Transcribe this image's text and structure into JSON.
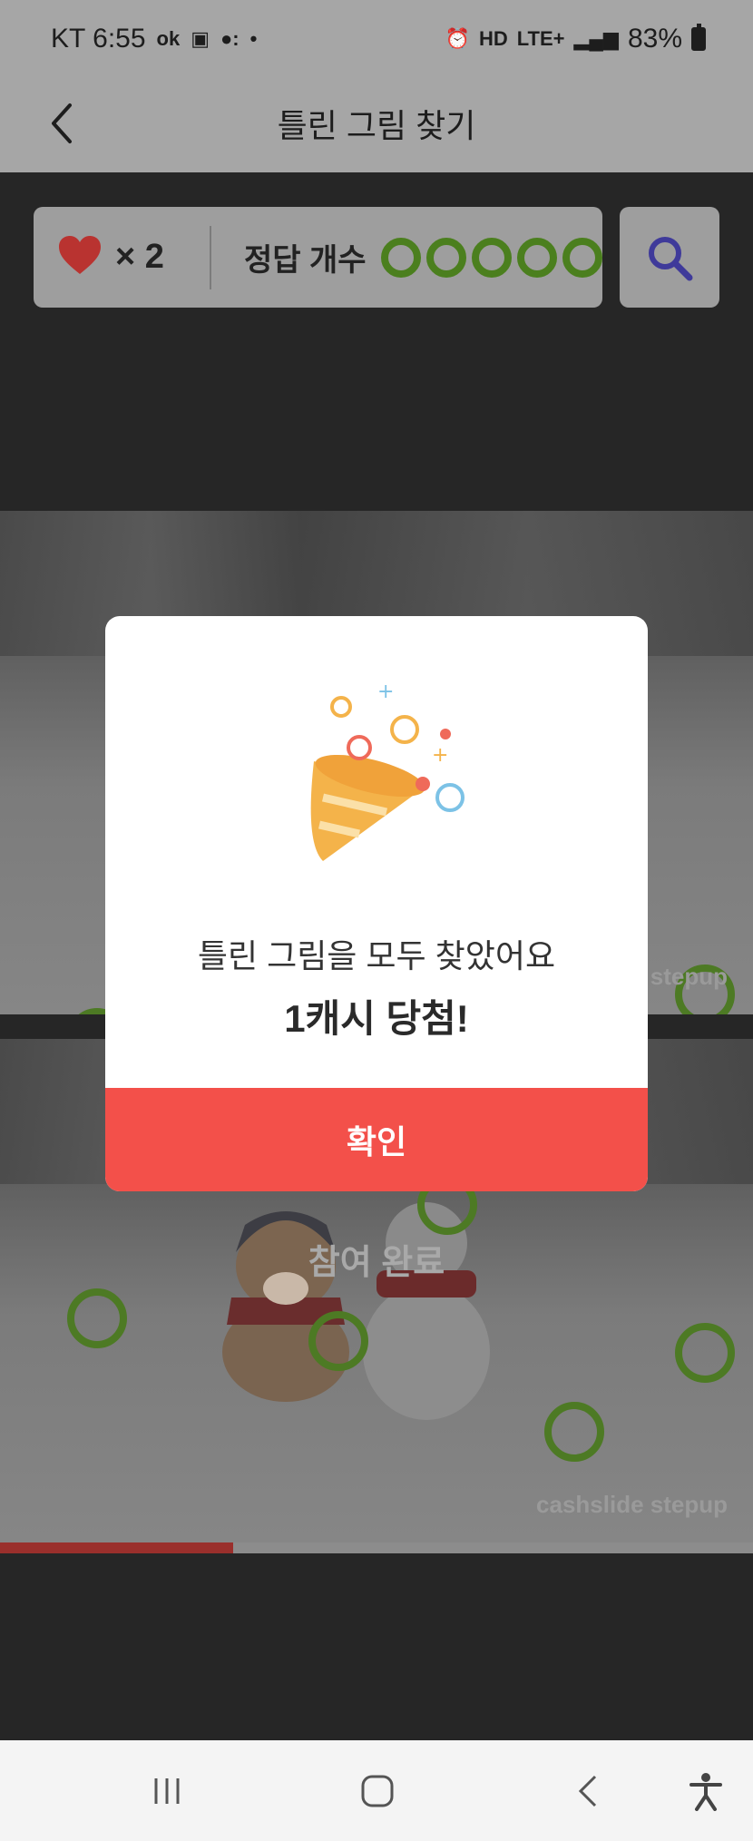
{
  "status_bar": {
    "carrier_time": "KT 6:55",
    "battery": "83%",
    "network": "LTE+"
  },
  "header": {
    "title": "틀린 그림 찾기"
  },
  "game": {
    "lives_count": "× 2",
    "answers_label": "정답 개수",
    "answers_found": 5,
    "answers_total": 5,
    "complete_label": "참여 완료",
    "watermark": "cashslide stepup",
    "progress_fraction": 0.31
  },
  "dialog": {
    "message": "틀린 그림을 모두 찾았어요",
    "reward": "1캐시 당첨!",
    "confirm_label": "확인"
  },
  "colors": {
    "accent": "#f3504a",
    "found_circle": "#4d7a24",
    "heart": "#c8302c"
  },
  "icons": [
    "back-arrow-icon",
    "heart-icon",
    "search-icon",
    "party-popper-icon",
    "recent-apps-icon",
    "home-icon",
    "nav-back-icon",
    "accessibility-icon"
  ]
}
